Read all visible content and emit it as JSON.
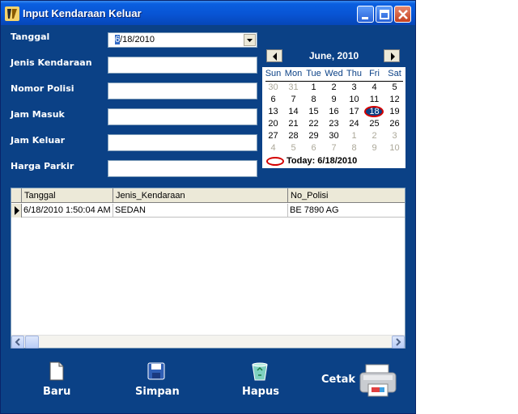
{
  "window": {
    "title": "Input Kendaraan Keluar"
  },
  "form": {
    "tanggal_label": "Tanggal",
    "tanggal_value_first": "6",
    "tanggal_value_rest": "/18/2010",
    "jenis_label": "Jenis Kendaraan",
    "jenis_value": "",
    "nomor_label": "Nomor Polisi",
    "nomor_value": "",
    "masuk_label": "Jam Masuk",
    "masuk_value": "",
    "keluar_label": "Jam Keluar",
    "keluar_value": "",
    "harga_label": "Harga Parkir",
    "harga_value": ""
  },
  "calendar": {
    "month_title": "June, 2010",
    "days_of_week": [
      "Sun",
      "Mon",
      "Tue",
      "Wed",
      "Thu",
      "Fri",
      "Sat"
    ],
    "weeks": [
      [
        "30",
        "31",
        "1",
        "2",
        "3",
        "4",
        "5"
      ],
      [
        "6",
        "7",
        "8",
        "9",
        "10",
        "11",
        "12"
      ],
      [
        "13",
        "14",
        "15",
        "16",
        "17",
        "18",
        "19"
      ],
      [
        "20",
        "21",
        "22",
        "23",
        "24",
        "25",
        "26"
      ],
      [
        "27",
        "28",
        "29",
        "30",
        "1",
        "2",
        "3"
      ],
      [
        "4",
        "5",
        "6",
        "7",
        "8",
        "9",
        "10"
      ]
    ],
    "today_label": "Today: 6/18/2010",
    "selected_day": "18"
  },
  "grid": {
    "columns": [
      "Tanggal",
      "Jenis_Kendaraan",
      "No_Polisi"
    ],
    "rows": [
      [
        "6/18/2010 1:50:04 AM",
        "SEDAN",
        "BE 7890 AG"
      ]
    ]
  },
  "toolbar": {
    "baru": "Baru",
    "simpan": "Simpan",
    "hapus": "Hapus",
    "cetak": "Cetak"
  },
  "colors": {
    "window_bg": "#0b4186",
    "titlebar": "#0854d4",
    "today_ring": "#d40000"
  }
}
